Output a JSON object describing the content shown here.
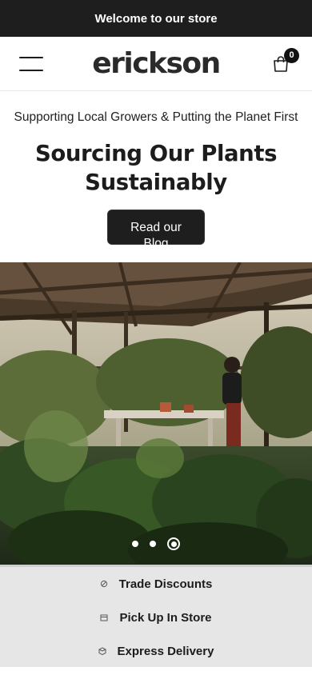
{
  "announcement": {
    "text": "Welcome to our store"
  },
  "header": {
    "logo": "erickson",
    "cart_count": "0"
  },
  "hero": {
    "subtitle": "Supporting Local Growers & Putting the Planet First",
    "title": "Sourcing Our Plants Sustainably",
    "button_label": "Read our Blog"
  },
  "slideshow": {
    "slide_count": 3,
    "active_index": 2
  },
  "features": [
    {
      "label": "Trade Discounts",
      "icon": "tag-icon"
    },
    {
      "label": "Pick Up In Store",
      "icon": "store-icon"
    },
    {
      "label": "Express Delivery",
      "icon": "delivery-icon"
    }
  ]
}
